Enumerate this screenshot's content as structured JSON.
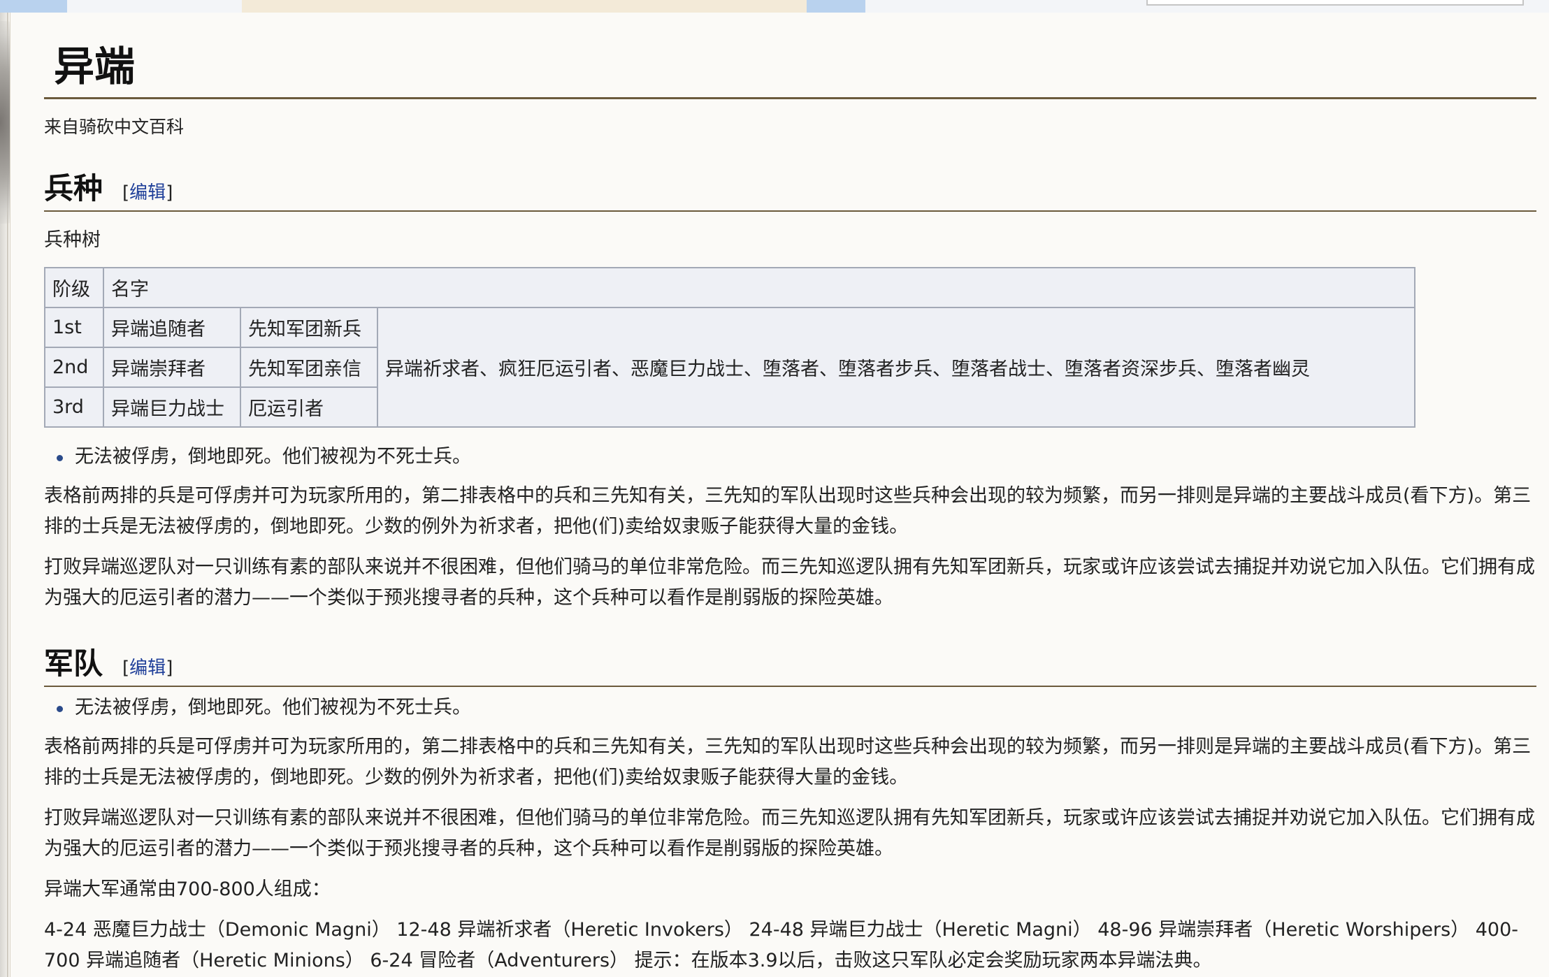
{
  "page": {
    "title": "异端",
    "from": "来自骑砍中文百科"
  },
  "section_troops": {
    "heading": "兵种",
    "edit_open": "[",
    "edit_label": "编辑",
    "edit_close": "]",
    "tree_label": "兵种树",
    "table": {
      "headers": [
        "阶级",
        "名字"
      ],
      "rows": [
        {
          "tier": "1st",
          "a": "异端追随者",
          "b": "先知军团新兵"
        },
        {
          "tier": "2nd",
          "a": "异端崇拜者",
          "b": "先知军团亲信"
        },
        {
          "tier": "3rd",
          "a": "异端巨力战士",
          "b": "厄运引者"
        }
      ],
      "merged_cell": "异端祈求者、疯狂厄运引者、恶魔巨力战士、堕落者、堕落者步兵、堕落者战士、堕落者资深步兵、堕落者幽灵"
    },
    "bullet": "无法被俘虏，倒地即死。他们被视为不死士兵。",
    "para1": "表格前两排的兵是可俘虏并可为玩家所用的，第二排表格中的兵和三先知有关，三先知的军队出现时这些兵种会出现的较为频繁，而另一排则是异端的主要战斗成员(看下方)。第三排的士兵是无法被俘虏的，倒地即死。少数的例外为祈求者，把他(们)卖给奴隶贩子能获得大量的金钱。",
    "para2": "打败异端巡逻队对一只训练有素的部队来说并不很困难，但他们骑马的单位非常危险。而三先知巡逻队拥有先知军团新兵，玩家或许应该尝试去捕捉并劝说它加入队伍。它们拥有成为强大的厄运引者的潜力——一个类似于预兆搜寻者的兵种，这个兵种可以看作是削弱版的探险英雄。"
  },
  "section_army": {
    "heading": "军队",
    "edit_open": "[",
    "edit_label": "编辑",
    "edit_close": "]",
    "bullet": "无法被俘虏，倒地即死。他们被视为不死士兵。",
    "para1": "表格前两排的兵是可俘虏并可为玩家所用的，第二排表格中的兵和三先知有关，三先知的军队出现时这些兵种会出现的较为频繁，而另一排则是异端的主要战斗成员(看下方)。第三排的士兵是无法被俘虏的，倒地即死。少数的例外为祈求者，把他(们)卖给奴隶贩子能获得大量的金钱。",
    "para2": "打败异端巡逻队对一只训练有素的部队来说并不很困难，但他们骑马的单位非常危险。而三先知巡逻队拥有先知军团新兵，玩家或许应该尝试去捕捉并劝说它加入队伍。它们拥有成为强大的厄运引者的潜力——一个类似于预兆搜寻者的兵种，这个兵种可以看作是削弱版的探险英雄。",
    "composition_intro": "异端大军通常由700-800人组成：",
    "composition": "4-24 恶魔巨力战士（Demonic Magni） 12-48 异端祈求者（Heretic Invokers） 24-48 异端巨力战士（Heretic Magni） 48-96 异端崇拜者（Heretic Worshipers） 400-700 异端追随者（Heretic Minions） 6-24 冒险者（Adventurers） 提示：在版本3.9以后，击败这只军队必定会奖励玩家两本异端法典。"
  },
  "colors": {
    "rule": "#6b5a3c",
    "link": "#1f3f99",
    "table_bg": "#eef0f5",
    "table_border": "#a3a9b6"
  }
}
